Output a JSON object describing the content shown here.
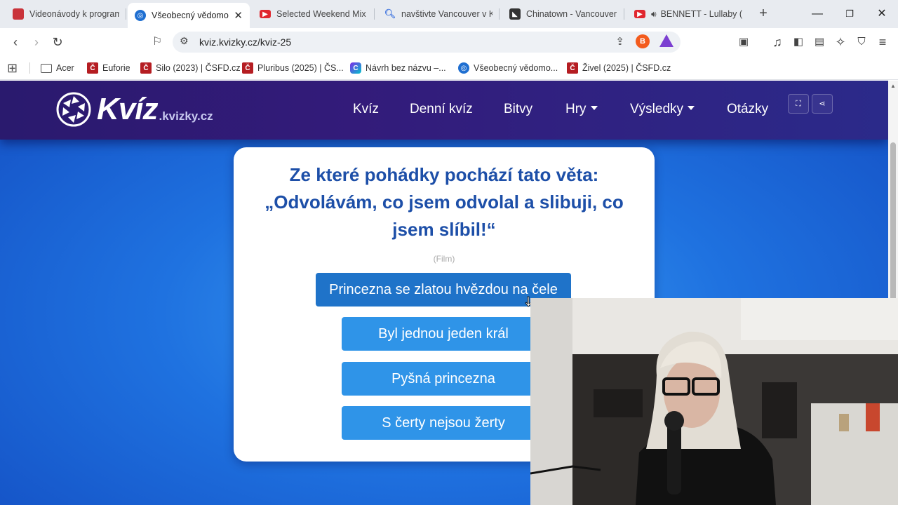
{
  "tabs": [
    {
      "title": "Videonávody k programu",
      "icon": "channel-icon",
      "color": "#c9333a"
    },
    {
      "title": "Všeobecný vědomo",
      "icon": "globe-icon",
      "color": "#1f6fd1",
      "active": true
    },
    {
      "title": "Selected Weekend Mix",
      "icon": "youtube-icon",
      "color": "#e0262e"
    },
    {
      "title": "navštivte Vancouver v K",
      "icon": "search-icon",
      "color": "#4b7de0"
    },
    {
      "title": "Chinatown - Vancouver",
      "icon": "site-icon",
      "color": "#333333"
    },
    {
      "title": "BENNETT - Lullaby (",
      "icon": "youtube-icon",
      "color": "#e0262e",
      "audio": true
    }
  ],
  "address_bar": {
    "url": "kviz.kvizky.cz/kviz-25"
  },
  "bookmarks": [
    {
      "label": "Acer",
      "icon": "folder-icon"
    },
    {
      "label": "Euforie",
      "icon": "csfd-icon"
    },
    {
      "label": "Silo (2023) | ČSFD.cz",
      "icon": "csfd-icon"
    },
    {
      "label": "Pluribus (2025) | ČS...",
      "icon": "csfd-icon"
    },
    {
      "label": "Návrh bez názvu –...",
      "icon": "canva-icon"
    },
    {
      "label": "Všeobecný vědomo...",
      "icon": "globe-icon"
    },
    {
      "label": "Živel (2025) | ČSFD.cz",
      "icon": "csfd-icon"
    }
  ],
  "site": {
    "logo": {
      "main": "Kvíz",
      "sub": ".kvizky.cz"
    },
    "nav": [
      "Kvíz",
      "Denní kvíz",
      "Bitvy",
      "Hry",
      "Výsledky",
      "Otázky"
    ]
  },
  "quiz": {
    "question": "Ze které pohádky pochází tato věta: „Odvolávám, co jsem odvolal a slibuji, co jsem slíbil!“",
    "category": "(Film)",
    "answers": [
      "Princezna se zlatou hvězdou na čele",
      "Byl jednou jeden král",
      "Pyšná princezna",
      "S čerty nejsou žerty"
    ]
  },
  "colors": {
    "nav_bg": "#2a1a6e",
    "page_bg": "#1f72e0",
    "question_text": "#1d4fa8",
    "answer_bg": "#2f94e8",
    "answer_hover_bg": "#1f73c9"
  }
}
